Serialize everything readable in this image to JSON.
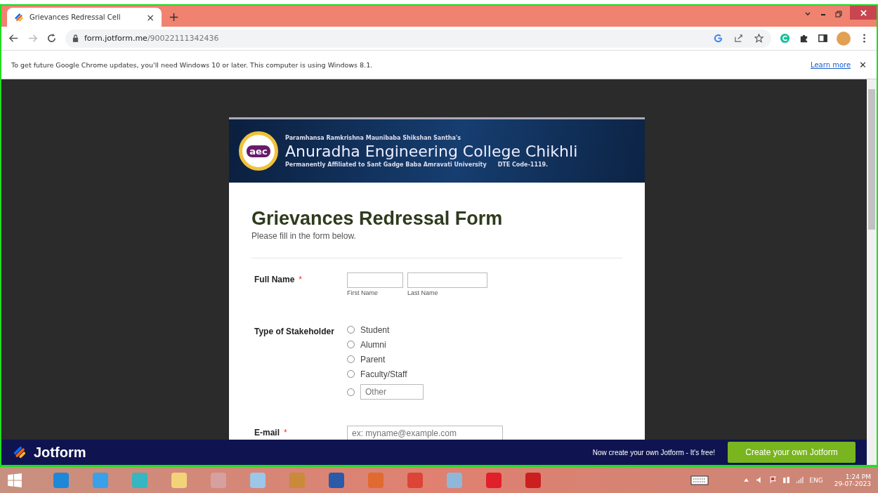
{
  "browser": {
    "tab": {
      "title": "Grievances Redressal Cell",
      "close": "×"
    },
    "new_tab": "+",
    "url_host": "form.jotform.me",
    "url_path": "/90022111342436"
  },
  "infobar": {
    "message": "To get future Google Chrome updates, you'll need Windows 10 or later. This computer is using Windows 8.1.",
    "link": "Learn more",
    "close": "✕"
  },
  "banner": {
    "logo_text": "aec",
    "society": "Paramhansa Ramkrishna Maunibaba Shikshan Santha's",
    "college": "Anuradha Engineering College Chikhli",
    "affiliation": "Permanently Affiliated to Sant Gadge Baba Amravati University",
    "code": "DTE Code-1119."
  },
  "form": {
    "title": "Grievances Redressal Form",
    "subtitle": "Please fill in the form below.",
    "full_name": {
      "label": "Full Name",
      "required_mark": "*",
      "sublabels": [
        "First Name",
        "Last Name"
      ]
    },
    "stakeholder": {
      "label": "Type of Stakeholder",
      "options": [
        {
          "kind": "radio",
          "label": "Student",
          "selected": false
        },
        {
          "kind": "radio",
          "label": "Alumni",
          "selected": false
        },
        {
          "kind": "radio",
          "label": "Parent",
          "selected": false
        },
        {
          "kind": "radio",
          "label": "Faculty/Staff",
          "selected": false
        },
        {
          "kind": "other",
          "placeholder": "Other",
          "selected": false
        }
      ]
    },
    "email": {
      "label": "E-mail",
      "required_mark": "*",
      "placeholder": "ex: myname@example.com"
    }
  },
  "jotform_bar": {
    "brand": "Jotform",
    "promo": "Now create your own Jotform - It's free!",
    "button": "Create your own Jotform"
  },
  "taskbar": {
    "language": "ENG",
    "time": "1:24 PM",
    "date": "29-07-2023"
  }
}
